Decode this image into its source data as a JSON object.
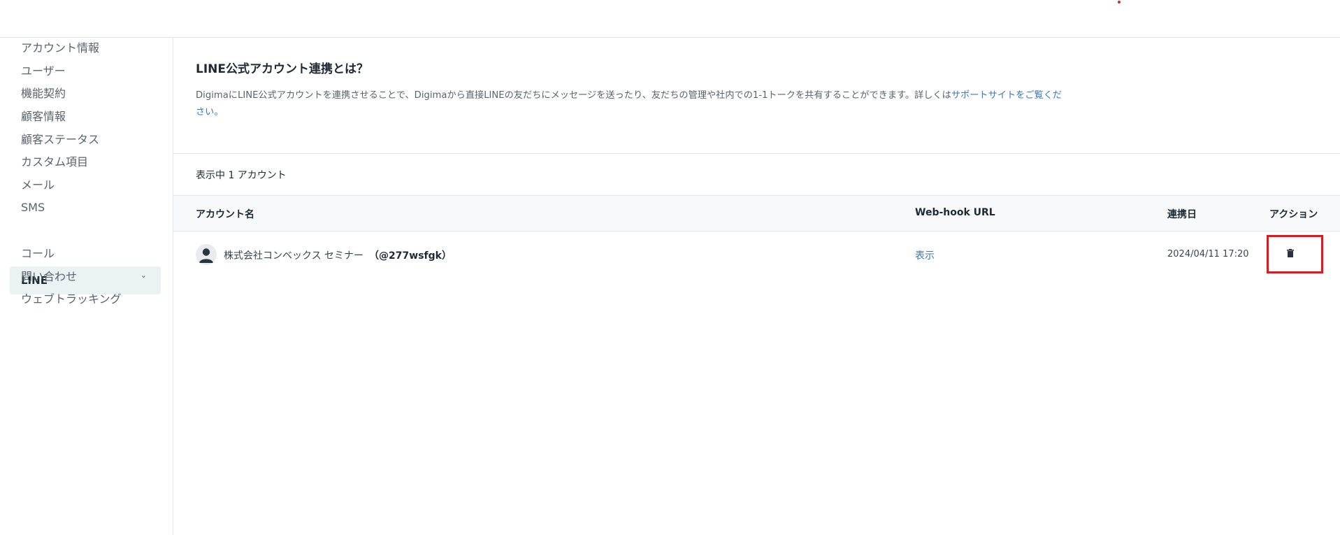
{
  "sidebar": {
    "items": [
      {
        "label": "アカウント情報"
      },
      {
        "label": "ユーザー"
      },
      {
        "label": "機能契約"
      },
      {
        "label": "顧客情報"
      },
      {
        "label": "顧客ステータス"
      },
      {
        "label": "カスタム項目"
      },
      {
        "label": "メール"
      },
      {
        "label": "SMS"
      },
      {
        "label": "LINE",
        "active": true
      },
      {
        "label": "コール"
      },
      {
        "label": "問い合わせ",
        "expandable": true
      },
      {
        "label": "ウェブトラッキング"
      }
    ]
  },
  "intro": {
    "title": "LINE公式アカウント連携とは？",
    "description": "DigimaにLINE公式アカウントを連携させることで、Digimaから直接LINEの友だちにメッセージを送ったり、友だちの管理や社内での1-1トークを共有することができます。詳しくは",
    "link_text": "サポートサイトをご覧ください。"
  },
  "count_text": "表示中 1 アカウント",
  "table": {
    "headers": {
      "account_name": "アカウント名",
      "webhook": "Web-hook URL",
      "linked_date": "連携日",
      "action": "アクション"
    },
    "rows": [
      {
        "name": "株式会社コンベックス セミナー",
        "line_id": "（@277wsfgk）",
        "webhook_link": "表示",
        "date": "2024/04/11 17:20",
        "action_icon": "trash-icon"
      }
    ]
  },
  "colors": {
    "accent_link": "#3a78c0",
    "highlight_box": "#e8131b",
    "active_nav_bg": "#ebf2f4"
  }
}
